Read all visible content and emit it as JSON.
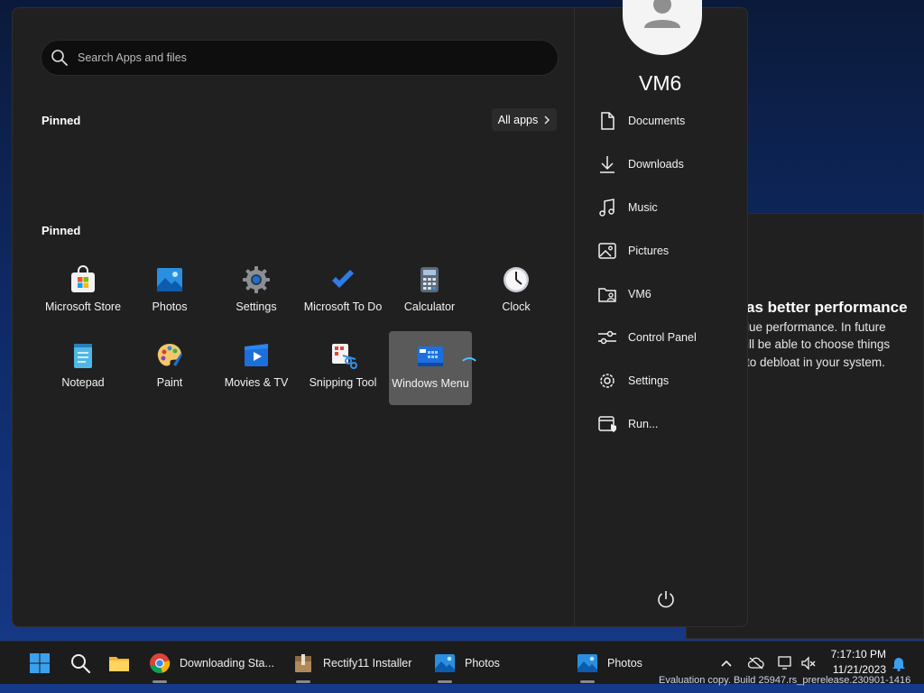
{
  "background_dialog": {
    "title": "as better performance",
    "lines": [
      "lue performance. In future",
      "ill be able to choose things",
      "to debloat in your system."
    ]
  },
  "search": {
    "placeholder": "Search Apps and files"
  },
  "sections": {
    "pinned_top": "Pinned",
    "pinned_bottom": "Pinned",
    "all_apps": "All apps"
  },
  "apps": [
    {
      "label": "Microsoft Store",
      "icon": "store-icon"
    },
    {
      "label": "Photos",
      "icon": "photos-icon"
    },
    {
      "label": "Settings",
      "icon": "settings-gear-icon"
    },
    {
      "label": "Microsoft To Do",
      "icon": "todo-check-icon"
    },
    {
      "label": "Calculator",
      "icon": "calculator-icon"
    },
    {
      "label": "Clock",
      "icon": "clock-icon"
    },
    {
      "label": "Notepad",
      "icon": "notepad-icon"
    },
    {
      "label": "Paint",
      "icon": "paint-palette-icon"
    },
    {
      "label": "Movies & TV",
      "icon": "movies-play-icon"
    },
    {
      "label": "Snipping Tool",
      "icon": "snipping-scissors-icon"
    },
    {
      "label": "Windows Menu",
      "icon": "windows-menu-icon"
    }
  ],
  "user": {
    "name": "VM6"
  },
  "places": [
    {
      "label": "Documents",
      "icon": "document-icon"
    },
    {
      "label": "Downloads",
      "icon": "download-icon"
    },
    {
      "label": "Music",
      "icon": "music-note-icon"
    },
    {
      "label": "Pictures",
      "icon": "picture-icon"
    },
    {
      "label": "VM6",
      "icon": "user-folder-icon"
    },
    {
      "label": "Control Panel",
      "icon": "sliders-icon"
    },
    {
      "label": "Settings",
      "icon": "gear-icon"
    },
    {
      "label": "Run...",
      "icon": "run-icon"
    }
  ],
  "taskbar": {
    "items": [
      {
        "label": "Downloading Sta..."
      },
      {
        "label": "Rectify11 Installer"
      },
      {
        "label": "Photos"
      },
      {
        "label": "Photos"
      }
    ],
    "time": "7:17:10 PM",
    "date": "11/21/2023"
  },
  "watermark": "Evaluation copy. Build 25947.rs_prerelease.230901-1416",
  "colors": {
    "accent": "#4cc2ff",
    "menu_bg": "#202020",
    "taskbar_bg": "#1c1c1c"
  }
}
